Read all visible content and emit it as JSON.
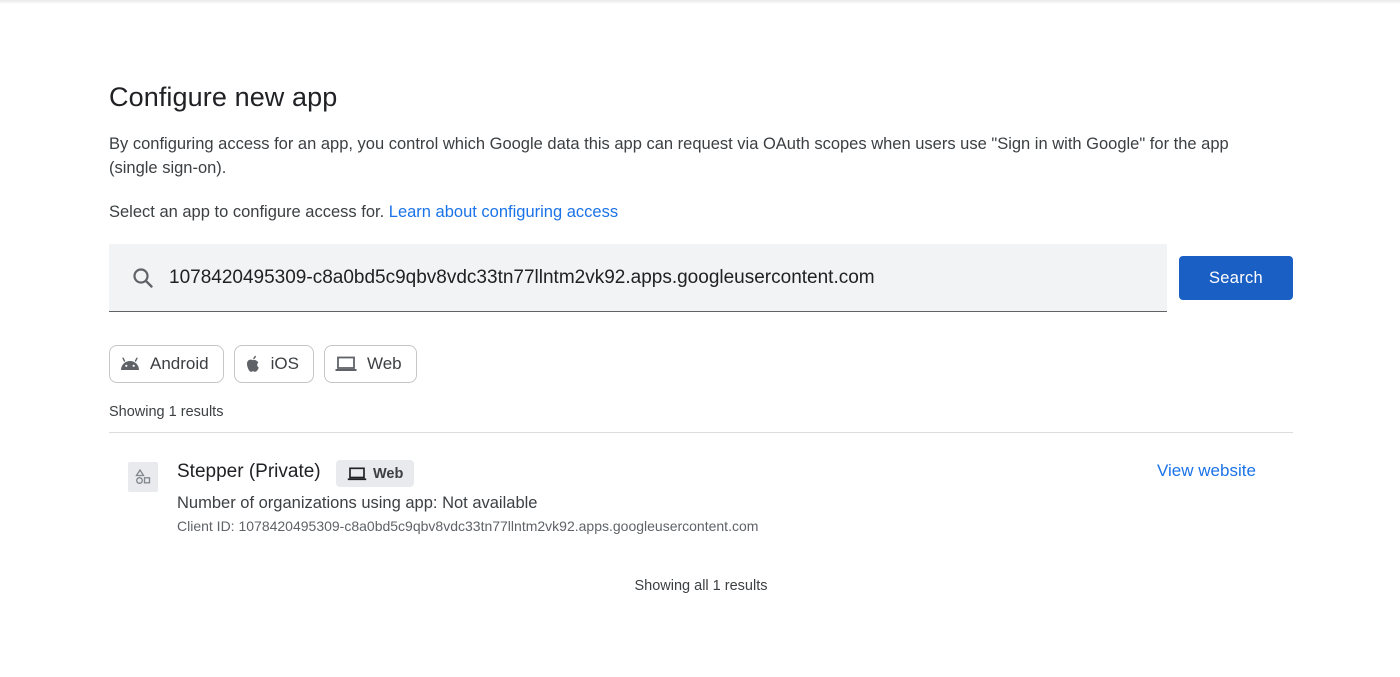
{
  "page": {
    "title": "Configure new app",
    "description": "By configuring access for an app, you control which Google data this app can request via OAuth scopes when users use \"Sign in with Google\" for the app (single sign-on).",
    "select_prompt": "Select an app to configure access for.",
    "learn_link": "Learn about configuring access"
  },
  "search": {
    "icon": "search-icon",
    "value": "1078420495309-c8a0bd5c9qbv8vdc33tn77llntm2vk92.apps.googleusercontent.com",
    "button_label": "Search"
  },
  "filters": [
    {
      "label": "Android",
      "icon": "android-icon"
    },
    {
      "label": "iOS",
      "icon": "apple-icon"
    },
    {
      "label": "Web",
      "icon": "laptop-icon"
    }
  ],
  "results": {
    "count_text": "Showing 1 results",
    "footer_text": "Showing all 1 results",
    "items": [
      {
        "name": "Stepper (Private)",
        "icon": "app-shapes-icon",
        "badge": "Web",
        "orgs": "Number of organizations using app: Not available",
        "client_id": "Client ID: 1078420495309-c8a0bd5c9qbv8vdc33tn77llntm2vk92.apps.googleusercontent.com",
        "link": "View website"
      }
    ]
  },
  "colors": {
    "primary_button": "#1a5fc4",
    "link": "#1a73e8",
    "search_bg": "#f1f3f4"
  }
}
